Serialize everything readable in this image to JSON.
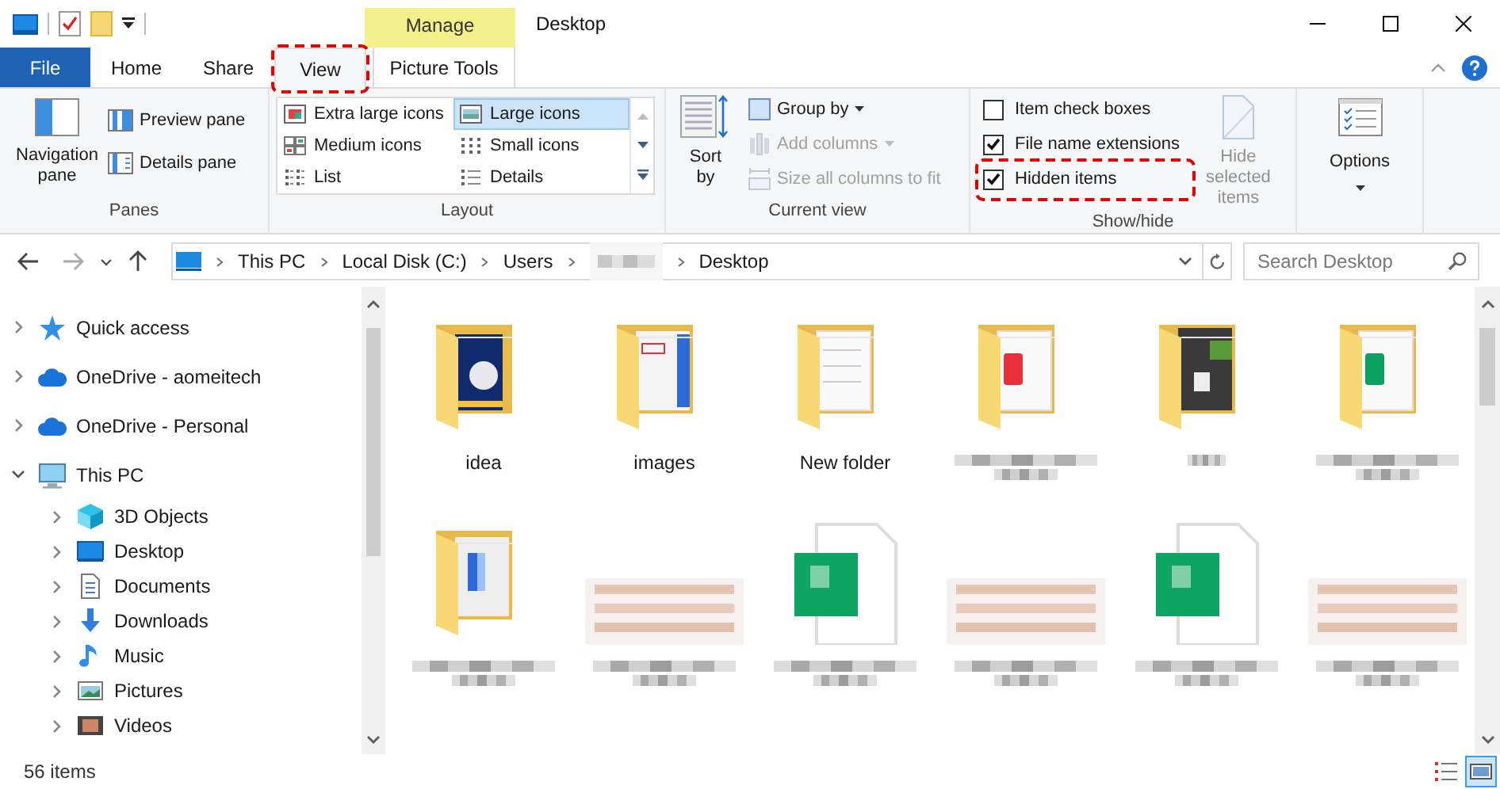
{
  "window": {
    "title": "Desktop",
    "context_tab": "Manage"
  },
  "tabs": [
    {
      "label": "File",
      "kind": "file",
      "selected": false,
      "annotated": false
    },
    {
      "label": "Home",
      "kind": "tab",
      "selected": false,
      "annotated": false
    },
    {
      "label": "Share",
      "kind": "tab",
      "selected": false,
      "annotated": false
    },
    {
      "label": "View",
      "kind": "tab",
      "selected": true,
      "annotated": true
    },
    {
      "label": "Picture Tools",
      "kind": "context",
      "selected": false,
      "annotated": false
    }
  ],
  "ribbon": {
    "panes": {
      "label": "Panes",
      "navigation": "Navigation pane",
      "buttons": [
        {
          "label": "Preview pane",
          "kind": "preview"
        },
        {
          "label": "Details pane",
          "kind": "details"
        }
      ]
    },
    "layout": {
      "label": "Layout",
      "options": [
        {
          "label": "Extra large icons",
          "kind": "xl",
          "selected": false
        },
        {
          "label": "Large icons",
          "kind": "large",
          "selected": true
        },
        {
          "label": "Medium icons",
          "kind": "medium",
          "selected": false
        },
        {
          "label": "Small icons",
          "kind": "small",
          "selected": false
        },
        {
          "label": "List",
          "kind": "list",
          "selected": false
        },
        {
          "label": "Details",
          "kind": "details",
          "selected": false
        }
      ]
    },
    "current_view": {
      "label": "Current view",
      "sort": "Sort by",
      "items": [
        {
          "label": "Group by",
          "kind": "group",
          "disabled": false
        },
        {
          "label": "Add columns",
          "kind": "columns",
          "disabled": true
        },
        {
          "label": "Size all columns to fit",
          "kind": "fit",
          "disabled": true
        }
      ]
    },
    "show_hide": {
      "label": "Show/hide",
      "checkboxes": [
        {
          "label": "Item check boxes",
          "checked": false,
          "annotated": false
        },
        {
          "label": "File name extensions",
          "checked": true,
          "annotated": false
        },
        {
          "label": "Hidden items",
          "checked": true,
          "annotated": true
        }
      ],
      "hide_selected": {
        "label": "Hide selected items",
        "disabled": true
      }
    },
    "options": {
      "label": "Options"
    }
  },
  "address": {
    "breadcrumbs": [
      {
        "kind": "text",
        "label": "This PC"
      },
      {
        "kind": "text",
        "label": "Local Disk (C:)"
      },
      {
        "kind": "text",
        "label": "Users"
      },
      {
        "kind": "redacted"
      },
      {
        "kind": "text",
        "label": "Desktop"
      }
    ],
    "search": {
      "placeholder": "Search Desktop"
    }
  },
  "navigation": [
    {
      "label": "Quick access",
      "kind": "star",
      "expanded": false
    },
    {
      "label": "OneDrive - aomeitech",
      "kind": "cloud",
      "expanded": false
    },
    {
      "label": "OneDrive - Personal",
      "kind": "cloud",
      "expanded": false
    },
    {
      "label": "This PC",
      "kind": "pc",
      "expanded": true,
      "children": [
        {
          "label": "3D Objects",
          "kind": "cube",
          "expanded": false
        },
        {
          "label": "Desktop",
          "kind": "desktop",
          "expanded": false
        },
        {
          "label": "Documents",
          "kind": "documents",
          "expanded": false
        },
        {
          "label": "Downloads",
          "kind": "downloads",
          "expanded": false
        },
        {
          "label": "Music",
          "kind": "music",
          "expanded": false
        },
        {
          "label": "Pictures",
          "kind": "pictures",
          "expanded": false
        },
        {
          "label": "Videos",
          "kind": "videos",
          "expanded": false
        }
      ]
    }
  ],
  "files": [
    {
      "label": "idea",
      "kind": "folder-photo"
    },
    {
      "label": "images",
      "kind": "folder-screenshot"
    },
    {
      "label": "New folder",
      "kind": "folder-form"
    },
    {
      "kind": "folder-red"
    },
    {
      "kind": "folder-dark"
    },
    {
      "kind": "folder-green"
    },
    {
      "kind": "folder-blue"
    },
    {
      "kind": "table"
    },
    {
      "kind": "sheet"
    },
    {
      "kind": "table"
    },
    {
      "kind": "sheet"
    },
    {
      "kind": "table"
    }
  ],
  "view_buttons": [
    {
      "kind": "details",
      "selected": false
    },
    {
      "kind": "large-icons",
      "selected": true
    }
  ],
  "status_bar": {
    "count": "56 items"
  }
}
